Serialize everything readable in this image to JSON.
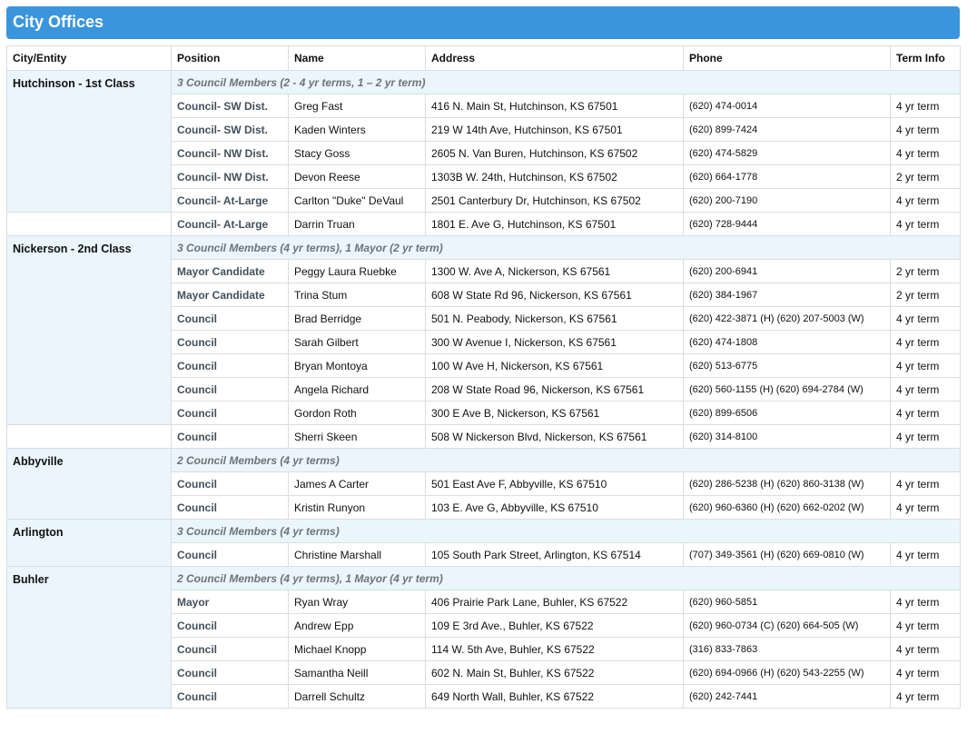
{
  "title": "City Offices",
  "columns": [
    "City/Entity",
    "Position",
    "Name",
    "Address",
    "Phone",
    "Term Info"
  ],
  "sections": [
    {
      "city": "Hutchinson - 1st Class",
      "group": "3 Council Members (2 - 4 yr terms, 1 – 2 yr term)",
      "rows": [
        [
          "Council- SW Dist.",
          "Greg Fast",
          "416 N. Main St, Hutchinson, KS 67501",
          "(620) 474-0014",
          "4 yr term"
        ],
        [
          "Council- SW Dist.",
          "Kaden Winters",
          "219 W 14th Ave, Hutchinson, KS 67501",
          "(620) 899-7424",
          "4 yr term"
        ],
        [
          "Council- NW Dist.",
          "Stacy Goss",
          "2605 N. Van Buren, Hutchinson, KS 67502",
          "(620) 474-5829",
          "4 yr term"
        ],
        [
          "Council- NW Dist.",
          "Devon Reese",
          "1303B W. 24th, Hutchinson, KS 67502",
          "(620) 664-1778",
          "2 yr term"
        ],
        [
          "Council- At-Large",
          "Carlton \"Duke\" DeVaul",
          "2501 Canterbury Dr, Hutchinson, KS 67502",
          "(620) 200-7190",
          "4 yr term"
        ],
        [
          "Council- At-Large",
          "Darrin Truan",
          "1801 E. Ave G, Hutchinson, KS 67501",
          "(620) 728-9444",
          "4 yr term"
        ]
      ]
    },
    {
      "city": "Nickerson - 2nd Class",
      "group": "3 Council Members (4 yr terms), 1 Mayor (2 yr term)",
      "rows": [
        [
          "Mayor Candidate",
          "Peggy Laura Ruebke",
          "1300 W. Ave A, Nickerson, KS 67561",
          "(620) 200-6941",
          "2 yr term"
        ],
        [
          "Mayor Candidate",
          "Trina Stum",
          "608 W State Rd 96, Nickerson, KS 67561",
          "(620) 384-1967",
          "2 yr term"
        ],
        [
          "Council",
          "Brad Berridge",
          "501 N. Peabody, Nickerson, KS 67561",
          "(620) 422-3871 (H) (620) 207-5003 (W)",
          "4 yr term"
        ],
        [
          "Council",
          "Sarah Gilbert",
          "300 W Avenue I, Nickerson, KS 67561",
          "(620) 474-1808",
          "4 yr term"
        ],
        [
          "Council",
          "Bryan Montoya",
          "100 W Ave H, Nickerson, KS 67561",
          "(620) 513-6775",
          "4 yr term"
        ],
        [
          "Council",
          "Angela Richard",
          "208 W State Road 96, Nickerson, KS 67561",
          "(620) 560-1155 (H) (620) 694-2784 (W)",
          "4 yr term"
        ],
        [
          "Council",
          "Gordon Roth",
          "300 E Ave B, Nickerson, KS 67561",
          "(620) 899-6506",
          "4 yr term"
        ],
        [
          "Council",
          "Sherri Skeen",
          "508 W Nickerson Blvd, Nickerson, KS 67561",
          "(620) 314-8100",
          "4 yr term"
        ]
      ]
    },
    {
      "city": "Abbyville",
      "group": "2 Council Members (4 yr terms)",
      "rows": [
        [
          "Council",
          "James A Carter",
          "501 East Ave F, Abbyville, KS 67510",
          "(620) 286-5238 (H) (620) 860-3138 (W)",
          "4 yr term"
        ],
        [
          "Council",
          "Kristin Runyon",
          "103 E. Ave G, Abbyville, KS 67510",
          "(620) 960-6360 (H) (620) 662-0202 (W)",
          "4 yr term"
        ]
      ]
    },
    {
      "city": "Arlington",
      "group": "3 Council Members (4 yr terms)",
      "rows": [
        [
          "Council",
          "Christine Marshall",
          "105 South Park Street, Arlington, KS 67514",
          "(707) 349-3561 (H) (620) 669-0810 (W)",
          "4 yr term"
        ]
      ]
    },
    {
      "city": "Buhler",
      "group": "2 Council Members (4 yr terms), 1 Mayor (4 yr term)",
      "rows": [
        [
          "Mayor",
          "Ryan Wray",
          "406 Prairie Park Lane, Buhler, KS 67522",
          "(620) 960-5851",
          "4 yr term"
        ],
        [
          "Council",
          "Andrew Epp",
          "109 E 3rd Ave., Buhler, KS 67522",
          "(620) 960-0734 (C) (620) 664-505 (W)",
          "4 yr term"
        ],
        [
          "Council",
          "Michael Knopp",
          "114 W. 5th Ave, Buhler, KS 67522",
          "(316) 833-7863",
          "4 yr term"
        ],
        [
          "Council",
          "Samantha Neill",
          "602 N. Main St, Buhler, KS 67522",
          "(620) 694-0966 (H) (620) 543-2255 (W)",
          "4 yr term"
        ],
        [
          "Council",
          "Darrell Schultz",
          "649 North Wall, Buhler, KS 67522",
          "(620) 242-7441",
          "4 yr term"
        ]
      ]
    }
  ],
  "colors": {
    "header_bg": "#3a95dc",
    "group_bg": "#eaf6fb",
    "border": "#d9dee2"
  }
}
